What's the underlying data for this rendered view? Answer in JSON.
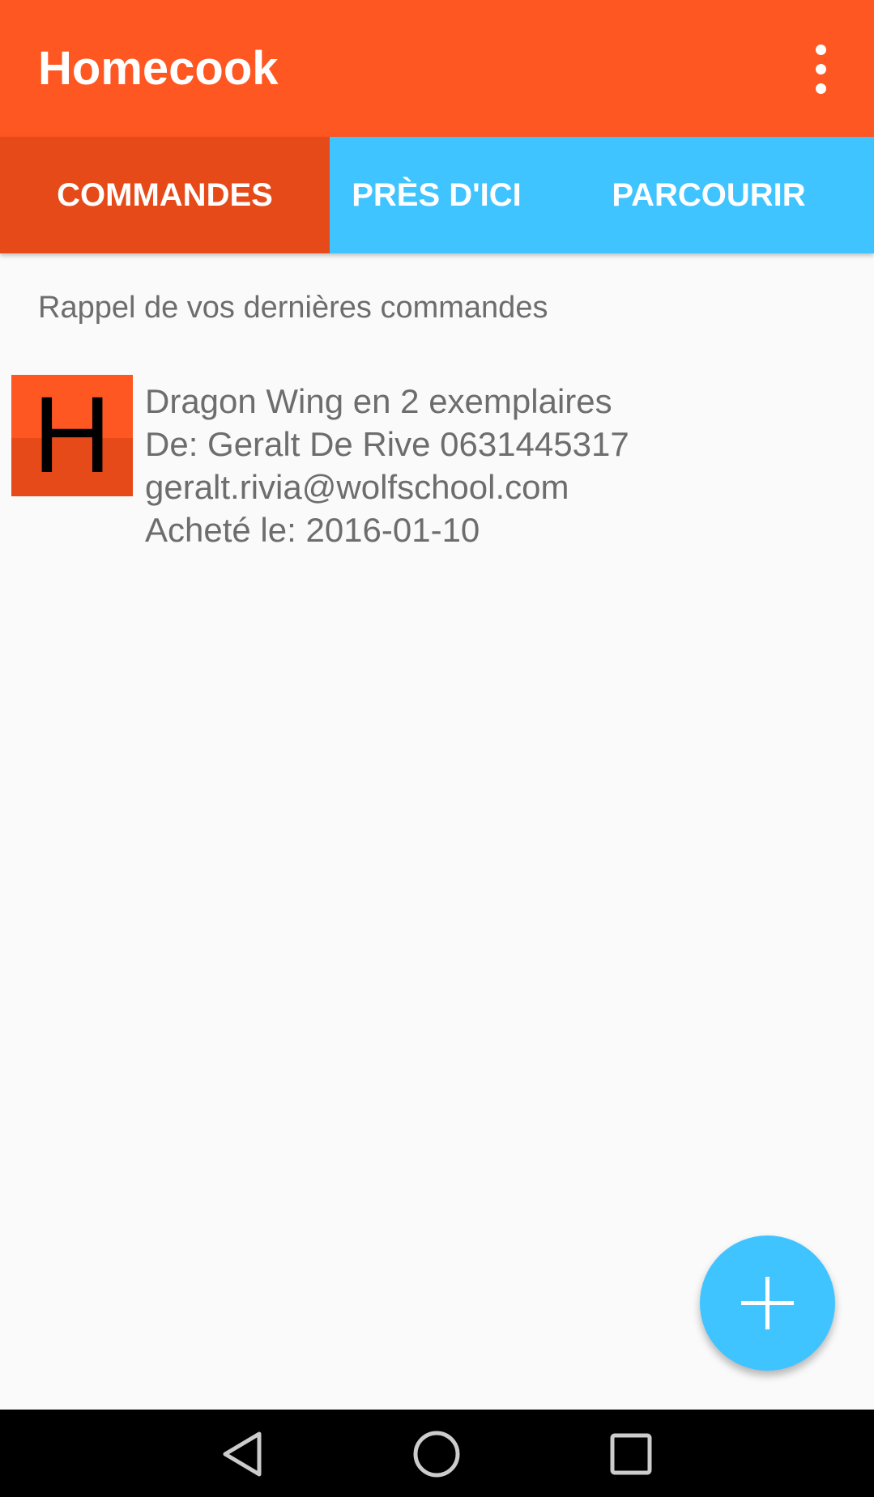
{
  "app_bar": {
    "title": "Homecook",
    "overflow_icon": "more-vertical-icon",
    "color": "#ff5722"
  },
  "tabs": [
    {
      "label": "COMMANDES",
      "active": true
    },
    {
      "label": "PRÈS D'ICI",
      "active": false
    },
    {
      "label": "PARCOURIR",
      "active": false
    }
  ],
  "tab_colors": {
    "active": "#e64a19",
    "inactive": "#40c4ff"
  },
  "main": {
    "heading": "Rappel de vos dernières commandes",
    "orders": [
      {
        "thumb_letter": "H",
        "title": "Dragon Wing en 2 exemplaires",
        "from": "De: Geralt De Rive 0631445317",
        "email": "geralt.rivia@wolfschool.com",
        "date": "Acheté le: 2016-01-10"
      }
    ]
  },
  "fab": {
    "icon": "plus-icon",
    "color": "#40c4ff"
  },
  "nav_bar": {
    "back_icon": "back-triangle-icon",
    "home_icon": "home-circle-icon",
    "recents_icon": "recents-square-icon"
  }
}
